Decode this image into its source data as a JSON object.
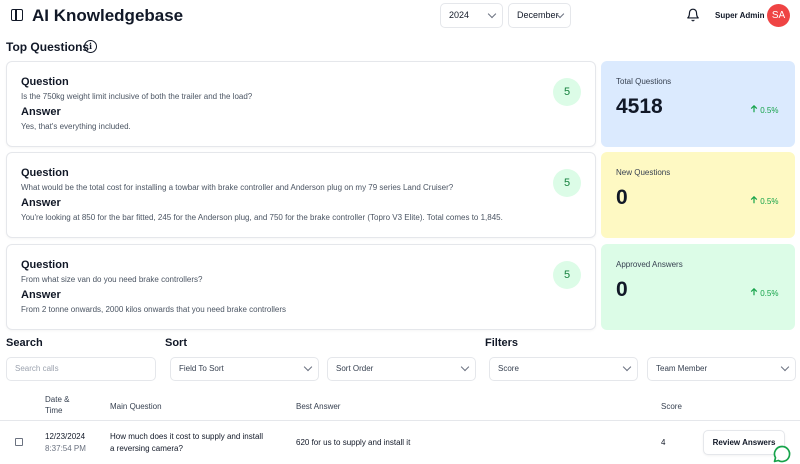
{
  "header": {
    "title": "AI Knowledgebase",
    "year": "2024",
    "month": "December",
    "user_name": "Super Admin",
    "avatar_initials": "SA",
    "avatar_color": "#ef4444"
  },
  "top_questions": {
    "title": "Top Questions",
    "question_heading": "Question",
    "answer_heading": "Answer",
    "items": [
      {
        "question": "Is the 750kg weight limit inclusive of both the trailer and the load?",
        "answer": "Yes, that's everything included.",
        "count": "5"
      },
      {
        "question": "What would be the total cost for installing a towbar with brake controller and Anderson plug on my 79 series Land Cruiser?",
        "answer": "You're looking at 850 for the bar fitted, 245 for the Anderson plug, and 750 for the brake controller (Topro V3 Elite). Total comes to 1,845.",
        "count": "5"
      },
      {
        "question": "From what size van do you need brake controllers?",
        "answer": "From 2 tonne onwards, 2000 kilos onwards that you need brake controllers",
        "count": "5"
      }
    ]
  },
  "stats": [
    {
      "label": "Total Questions",
      "value": "4518",
      "change": "0.5%",
      "bg": "#dbeafe"
    },
    {
      "label": "New Questions",
      "value": "0",
      "change": "0.5%",
      "bg": "#fef9c3"
    },
    {
      "label": "Approved Answers",
      "value": "0",
      "change": "0.5%",
      "bg": "#dcfce7"
    }
  ],
  "controls": {
    "search_label": "Search",
    "search_placeholder": "Search calls",
    "sort_label": "Sort",
    "sort_field": "Field To Sort",
    "sort_order": "Sort Order",
    "filters_label": "Filters",
    "filter_score": "Score",
    "filter_team": "Team Member"
  },
  "table": {
    "headers": {
      "date_line1": "Date &",
      "date_line2": "Time",
      "main_question": "Main Question",
      "best_answer": "Best Answer",
      "score": "Score"
    },
    "rows": [
      {
        "date": "12/23/2024",
        "time": "8:37:54 PM",
        "question_line1": "How much does it cost to supply and install",
        "question_line2": "a reversing camera?",
        "answer": "620 for us to supply and install it",
        "score": "4",
        "action": "Review Answers"
      }
    ]
  },
  "accent_color": "#16a34a",
  "icons": [
    "sidebar-toggle-icon",
    "bell-icon",
    "info-icon",
    "chevron-down-icon",
    "arrow-up-icon",
    "chat-icon"
  ]
}
